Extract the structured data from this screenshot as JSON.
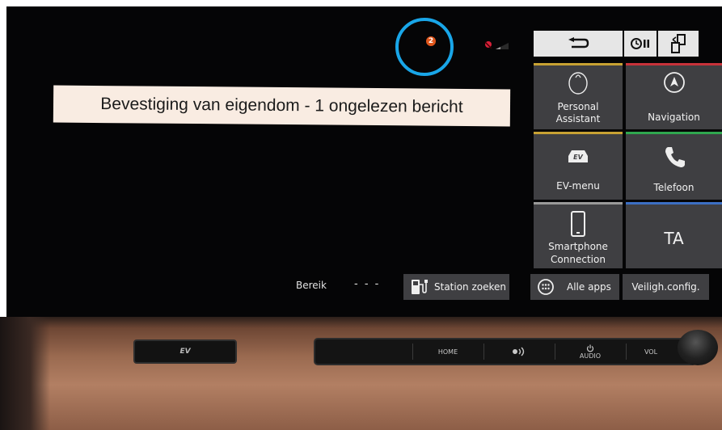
{
  "notification": {
    "count": "2"
  },
  "banner": {
    "text": "Bevestiging van eigendom - 1 ongelezen bericht"
  },
  "top_buttons": [
    {
      "id": "back",
      "icon": "back-arrow-icon"
    },
    {
      "id": "history",
      "icon": "clock-history-icon"
    },
    {
      "id": "switch",
      "icon": "screen-switch-icon"
    }
  ],
  "tiles": {
    "personal_assistant": {
      "label_line1": "Personal",
      "label_line2": "Assistant",
      "accent": "#c8a233"
    },
    "navigation": {
      "label": "Navigation",
      "accent": "#c8323a"
    },
    "ev_menu": {
      "label": "EV-menu",
      "badge": "EV",
      "accent": "#c8a233"
    },
    "telefoon": {
      "label": "Telefoon",
      "accent": "#2fa84f"
    },
    "smartphone": {
      "label_line1": "Smartphone",
      "label_line2": "Connection",
      "accent": "#9a9a9a"
    },
    "ta": {
      "label": "TA",
      "accent": "#3c6fc4"
    }
  },
  "bottom": {
    "bereik_label": "Bereik",
    "bereik_value": "- - -",
    "station_button": "Station zoeken",
    "apps_button": "Alle apps",
    "safety_button": "Veiligh.config."
  },
  "hardware": {
    "left_button": "EV",
    "home": "HOME",
    "audio": "AUDIO",
    "vol": "VOL"
  }
}
